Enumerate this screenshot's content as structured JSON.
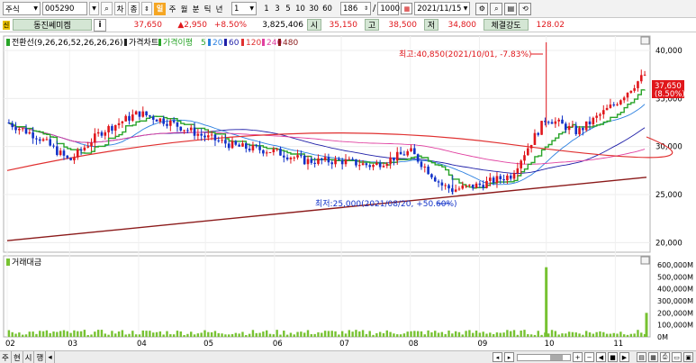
{
  "toolbar": {
    "market": "주식",
    "code": "005290",
    "modes": [
      "차",
      "종"
    ],
    "period_label_prefix": "일",
    "periods": [
      "주",
      "월",
      "분",
      "틱",
      "년"
    ],
    "period_select": "1",
    "minute_options": [
      "1",
      "3",
      "5",
      "10",
      "30",
      "60"
    ],
    "count_value": "186",
    "count_total": "1000",
    "date": "2021/11/15",
    "date_icon": "calendar-icon"
  },
  "info": {
    "name": "동진쎄미켐",
    "info_icon": "i",
    "price": "37,650",
    "change": "▲2,950",
    "change_pct": "+8.50%",
    "volume": "3,825,406",
    "open_label": "시",
    "open": "35,150",
    "high_label": "고",
    "high": "38,500",
    "low_label": "저",
    "low": "34,800",
    "strength_label": "체결강도",
    "strength": "128.02"
  },
  "legend": {
    "ichimoku": "전환선(9,26,26,52,26,26,26)",
    "price_chart": "가격차트",
    "ma_label": "가격이평",
    "ma_periods": [
      "5",
      "20",
      "60",
      "120",
      "240",
      "480"
    ],
    "volume_label": "거래대금"
  },
  "annotations": {
    "high": "최고:40,850(2021/10/01, -7.83%)",
    "low": "최저:25,000(2021/08/20, +50.60%)",
    "current_price": "37,650",
    "current_pct": "(8.50%)"
  },
  "colors": {
    "up": "#e0161b",
    "down": "#1232c8",
    "ma5": "#28a428",
    "ma20": "#2a7fe0",
    "ma60": "#1f1fa8",
    "ma120": "#e03030",
    "ma240": "#e040a0",
    "ma480": "#8b1a1a",
    "volume": "#77c232"
  },
  "chart_data": {
    "type": "candlestick",
    "x_ticks": [
      "02",
      "03",
      "04",
      "05",
      "06",
      "07",
      "08",
      "09",
      "10",
      "11"
    ],
    "y_ticks": [
      "40,000",
      "35,000",
      "30,000",
      "25,000",
      "20,000"
    ],
    "ylim": [
      20000,
      40850
    ],
    "volume_ticks": [
      "600,000M",
      "500,000M",
      "400,000M",
      "300,000M",
      "200,000M",
      "100,000M",
      "0M"
    ],
    "volume_ylim": [
      0,
      600000
    ],
    "price_series": [
      {
        "x": "2021-02-01",
        "close": 32500
      },
      {
        "x": "2021-02-15",
        "close": 31000
      },
      {
        "x": "2021-03-01",
        "close": 28500
      },
      {
        "x": "2021-03-15",
        "close": 31500
      },
      {
        "x": "2021-04-01",
        "close": 33500
      },
      {
        "x": "2021-04-15",
        "close": 32500
      },
      {
        "x": "2021-05-01",
        "close": 31000
      },
      {
        "x": "2021-05-15",
        "close": 30000
      },
      {
        "x": "2021-06-01",
        "close": 29500
      },
      {
        "x": "2021-06-15",
        "close": 28500
      },
      {
        "x": "2021-07-01",
        "close": 28500
      },
      {
        "x": "2021-07-15",
        "close": 28000
      },
      {
        "x": "2021-08-01",
        "close": 29500
      },
      {
        "x": "2021-08-15",
        "close": 26000
      },
      {
        "x": "2021-08-20",
        "close": 25500
      },
      {
        "x": "2021-09-01",
        "close": 26000
      },
      {
        "x": "2021-09-15",
        "close": 27000
      },
      {
        "x": "2021-10-01",
        "close": 33000
      },
      {
        "x": "2021-10-15",
        "close": 31500
      },
      {
        "x": "2021-11-01",
        "close": 34500
      },
      {
        "x": "2021-11-15",
        "close": 37650
      }
    ],
    "volume_series": [
      {
        "x": "2021-10-01",
        "value": 580000
      },
      {
        "x": "2021-11-15",
        "value": 200000
      }
    ]
  }
}
